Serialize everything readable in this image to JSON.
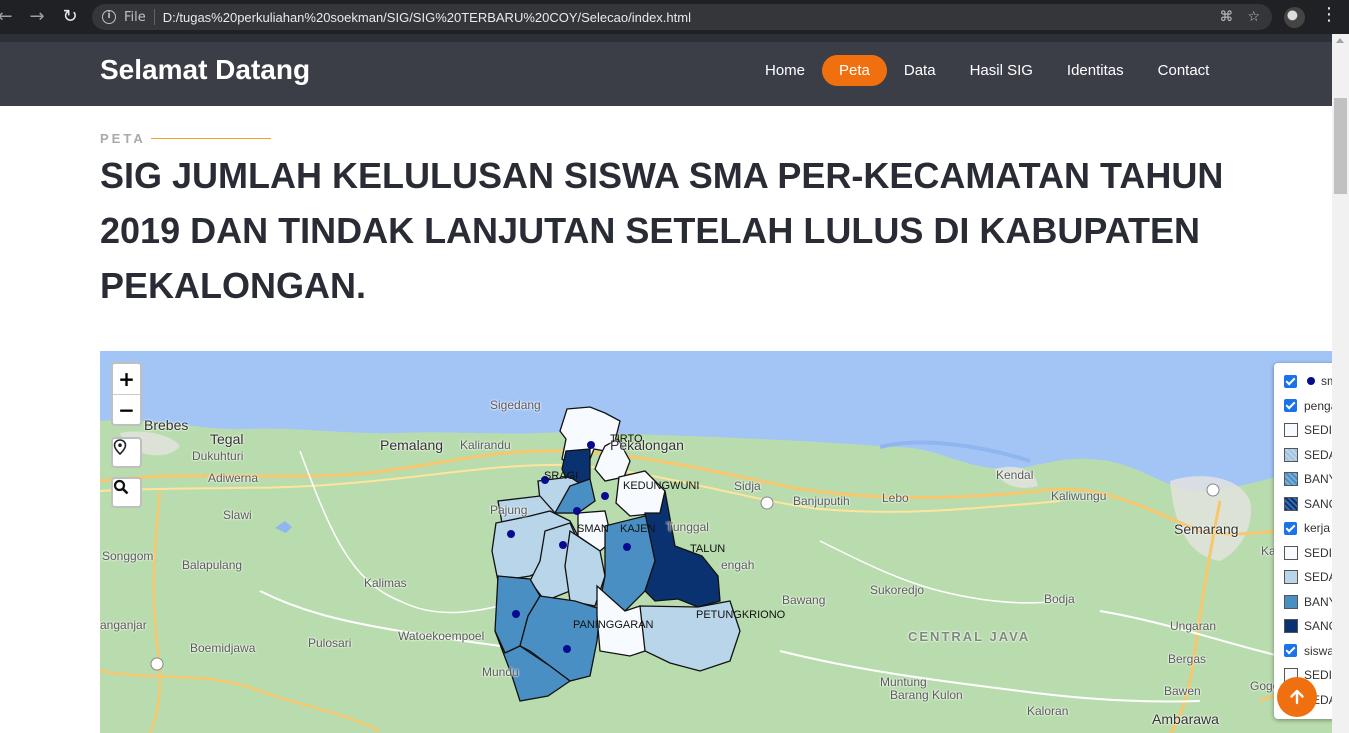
{
  "browser": {
    "file_label": "File",
    "url": "D:/tugas%20perkuliahan%20soekman/SIG/SIG%20TERBARU%20COY/Selecao/index.html"
  },
  "header": {
    "brand": "Selamat Datang",
    "nav": [
      "Home",
      "Peta",
      "Data",
      "Hasil SIG",
      "Identitas",
      "Contact"
    ],
    "active_nav": "Peta",
    "accent": "#f07010"
  },
  "section": {
    "label": "PETA",
    "title": "SIG JUMLAH KELULUSAN SISWA SMA PER-KECAMATAN TAHUN 2019 DAN TINDAK LANJUTAN SETELAH LULUS DI KABUPATEN PEKALONGAN."
  },
  "map": {
    "zoom_in": "+",
    "zoom_out": "−",
    "places": {
      "brebes": "Brebes",
      "tegal": "Tegal",
      "dukuhturi": "Dukuhturi",
      "adiwerna": "Adiwerna",
      "slawi": "Slawi",
      "songgom": "Songgom",
      "balapulang": "Balapulang",
      "anganjar": "anganjar",
      "boemidjawa": "Boemidjawa",
      "pulosari": "Pulosari",
      "watoekoempoel": "Watoekoempoel",
      "kalimas": "Kalimas",
      "pemalang": "Pemalang",
      "kalirandu": "Kalirandu",
      "sigedang": "Sigedang",
      "pajung": "Pajung",
      "pekalongan": "Pekalongan",
      "sidja": "Sidja",
      "banjuputih": "Banjuputih",
      "lebo": "Lebo",
      "kendal": "Kendal",
      "kaliwungu": "Kaliwungu",
      "semarang": "Semarang",
      "karan": "Karan",
      "sukoredjo": "Sukoredjo",
      "bawang": "Bawang",
      "bodja": "Bodja",
      "central_java": "CENTRAL JAVA",
      "ungaran": "Ungaran",
      "bergas": "Bergas",
      "bawen": "Bawen",
      "gogoda": "Gogoda",
      "ambarawa": "Ambarawa",
      "muntung": "Muntung",
      "barang_kulon": "Barang Kulon",
      "kaloran": "Kaloran",
      "mundu": "Mundu",
      "tunggal": "Tunggal",
      "engah": "engah"
    },
    "polygon_labels": {
      "tirto": "TIRTO",
      "kedungwuni": "KEDUNGWUNI",
      "karanganyar": "KAJEN",
      "sragi": "SRAGI",
      "talun": "TALUN",
      "doro": "SMAN",
      "paninggaran": "PANINGGARAN",
      "petungkriono": "PETUNGKRIONO"
    },
    "layers": [
      {
        "type": "check",
        "label": "sma",
        "dot": true
      },
      {
        "type": "check",
        "label": "pengangguran"
      },
      {
        "type": "swatch",
        "label": "SEDIKIT",
        "color": "#f7fbff"
      },
      {
        "type": "swatch",
        "label": "SEDANG",
        "color": "#b9d5ea"
      },
      {
        "type": "swatch",
        "label": "BANYAK",
        "color": "#4a8fc4"
      },
      {
        "type": "swatch",
        "label": "SANGAT",
        "color": "#0a3270"
      },
      {
        "type": "check",
        "label": "kerja"
      },
      {
        "type": "swatch",
        "label": "SEDIKIT",
        "color": "#f7fbff"
      },
      {
        "type": "swatch",
        "label": "SEDANG",
        "color": "#b9d5ea"
      },
      {
        "type": "swatch",
        "label": "BANYAK",
        "color": "#4a8fc4"
      },
      {
        "type": "swatch",
        "label": "SANGAT",
        "color": "#0a3270"
      },
      {
        "type": "check",
        "label": "siswa"
      },
      {
        "type": "swatch",
        "label": "SEDIKIT",
        "color": "#f7fbff"
      },
      {
        "type": "swatch",
        "label": "SEDANG",
        "color": "#b9d5ea"
      }
    ]
  }
}
